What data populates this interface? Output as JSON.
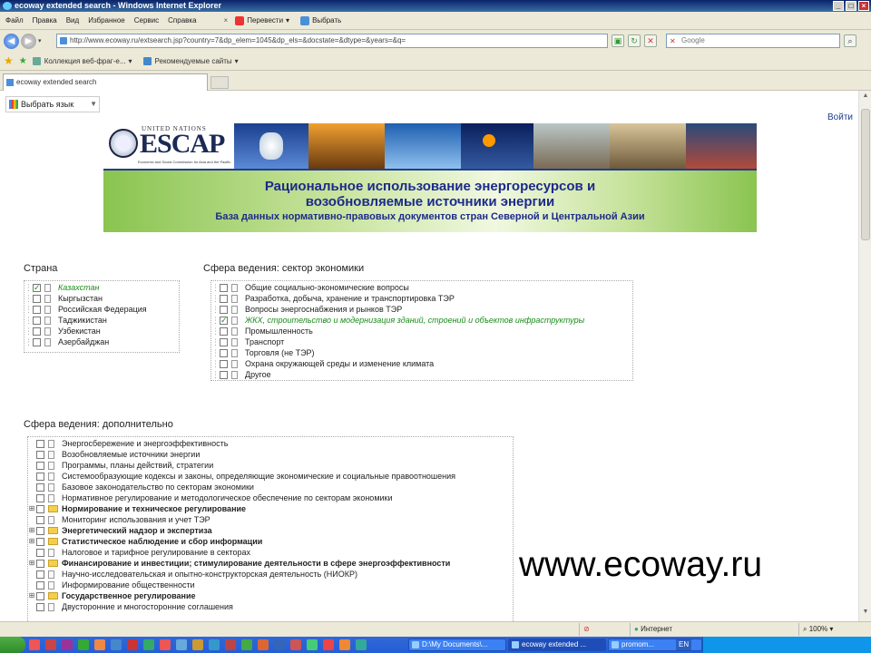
{
  "window": {
    "title": "ecoway extended search - Windows Internet Explorer"
  },
  "menu": {
    "items": [
      "Файл",
      "Правка",
      "Вид",
      "Избранное",
      "Сервис",
      "Справка"
    ],
    "close": "×",
    "translate": "Перевести",
    "select": "Выбрать"
  },
  "address": {
    "url": "http://www.ecoway.ru/extsearch.jsp?country=7&dp_elem=1045&dp_els=&docstate=&dtype=&years=&q=",
    "search_placeholder": "Google"
  },
  "favorites": {
    "items": [
      "Коллекция веб-фраг-е...",
      "Рекомендуемые сайты"
    ]
  },
  "tab": {
    "label": "ecoway extended search"
  },
  "page": {
    "lang_select": "Выбрать язык",
    "login": "Войти",
    "banner": {
      "un": "UNITED NATIONS",
      "escap": "ESCAP",
      "escap_sub": "Economic and Social Commission for Asia and the Pacific",
      "title_line1": "Рациональное использование энергоресурсов и",
      "title_line2": "возобновляемые источники энергии",
      "subtitle": "База данных нормативно-правовых документов стран Северной и Центральной Азии"
    },
    "country_header": "Страна",
    "countries": [
      {
        "label": "Казахстан",
        "checked": true
      },
      {
        "label": "Кыргызстан",
        "checked": false
      },
      {
        "label": "Российская Федерация",
        "checked": false
      },
      {
        "label": "Таджикистан",
        "checked": false
      },
      {
        "label": "Узбекистан",
        "checked": false
      },
      {
        "label": "Азербайджан",
        "checked": false
      }
    ],
    "sector_header": "Сфера ведения: сектор экономики",
    "sectors": [
      {
        "label": "Общие социально-экономические вопросы",
        "checked": false
      },
      {
        "label": "Разработка, добыча, хранение и транспортировка ТЭР",
        "checked": false
      },
      {
        "label": "Вопросы энергоснабжения и рынков ТЭР",
        "checked": false
      },
      {
        "label": "ЖКХ, строительство и модернизация зданий, строений и объектов инфраструктуры",
        "checked": true
      },
      {
        "label": "Промышленность",
        "checked": false
      },
      {
        "label": "Транспорт",
        "checked": false
      },
      {
        "label": "Торговля (не ТЭР)",
        "checked": false
      },
      {
        "label": "Охрана окружающей среды и изменение климата",
        "checked": false
      },
      {
        "label": "Другое",
        "checked": false
      }
    ],
    "extra_header": "Сфера ведения: дополнительно",
    "extras": [
      {
        "label": "Энергосбережение и энергоэффективность",
        "folder": false,
        "bold": false,
        "expand": false
      },
      {
        "label": "Возобновляемые источники энергии",
        "folder": false,
        "bold": false,
        "expand": false
      },
      {
        "label": "Программы, планы действий, стратегии",
        "folder": false,
        "bold": false,
        "expand": false
      },
      {
        "label": "Системообразующие кодексы и законы, определяющие экономические и социальные правоотношения",
        "folder": false,
        "bold": false,
        "expand": false
      },
      {
        "label": "Базовое законодательство по секторам экономики",
        "folder": false,
        "bold": false,
        "expand": false
      },
      {
        "label": "Нормативное регулирование и методологическое обеспечение по секторам экономики",
        "folder": false,
        "bold": false,
        "expand": false
      },
      {
        "label": "Нормирование и техническое регулирование",
        "folder": true,
        "bold": true,
        "expand": true
      },
      {
        "label": "Мониторинг использования и учет ТЭР",
        "folder": false,
        "bold": false,
        "expand": false
      },
      {
        "label": "Энергетический надзор и экспертиза",
        "folder": true,
        "bold": true,
        "expand": true
      },
      {
        "label": "Статистическое наблюдение и сбор информации",
        "folder": true,
        "bold": true,
        "expand": true
      },
      {
        "label": "Налоговое и тарифное регулирование в секторах",
        "folder": false,
        "bold": false,
        "expand": false
      },
      {
        "label": "Финансирование и инвестиции; стимулирование деятельности в сфере энергоэффективности",
        "folder": true,
        "bold": true,
        "expand": true
      },
      {
        "label": "Научно-исследовательская и опытно-конструкторская деятельность (НИОКР)",
        "folder": false,
        "bold": false,
        "expand": false
      },
      {
        "label": "Информирование общественности",
        "folder": false,
        "bold": false,
        "expand": false
      },
      {
        "label": "Государственное регулирование",
        "folder": true,
        "bold": true,
        "expand": true
      },
      {
        "label": "Двусторонние и многосторонние соглашения",
        "folder": false,
        "bold": false,
        "expand": false
      }
    ],
    "watermark": "www.ecoway.ru"
  },
  "status": {
    "zone": "Интернет",
    "zoom": "100%"
  },
  "taskbar": {
    "tasks": [
      "D:\\My Documents\\...",
      "ecoway extended ...",
      "рromom..."
    ],
    "lang": "EN"
  }
}
